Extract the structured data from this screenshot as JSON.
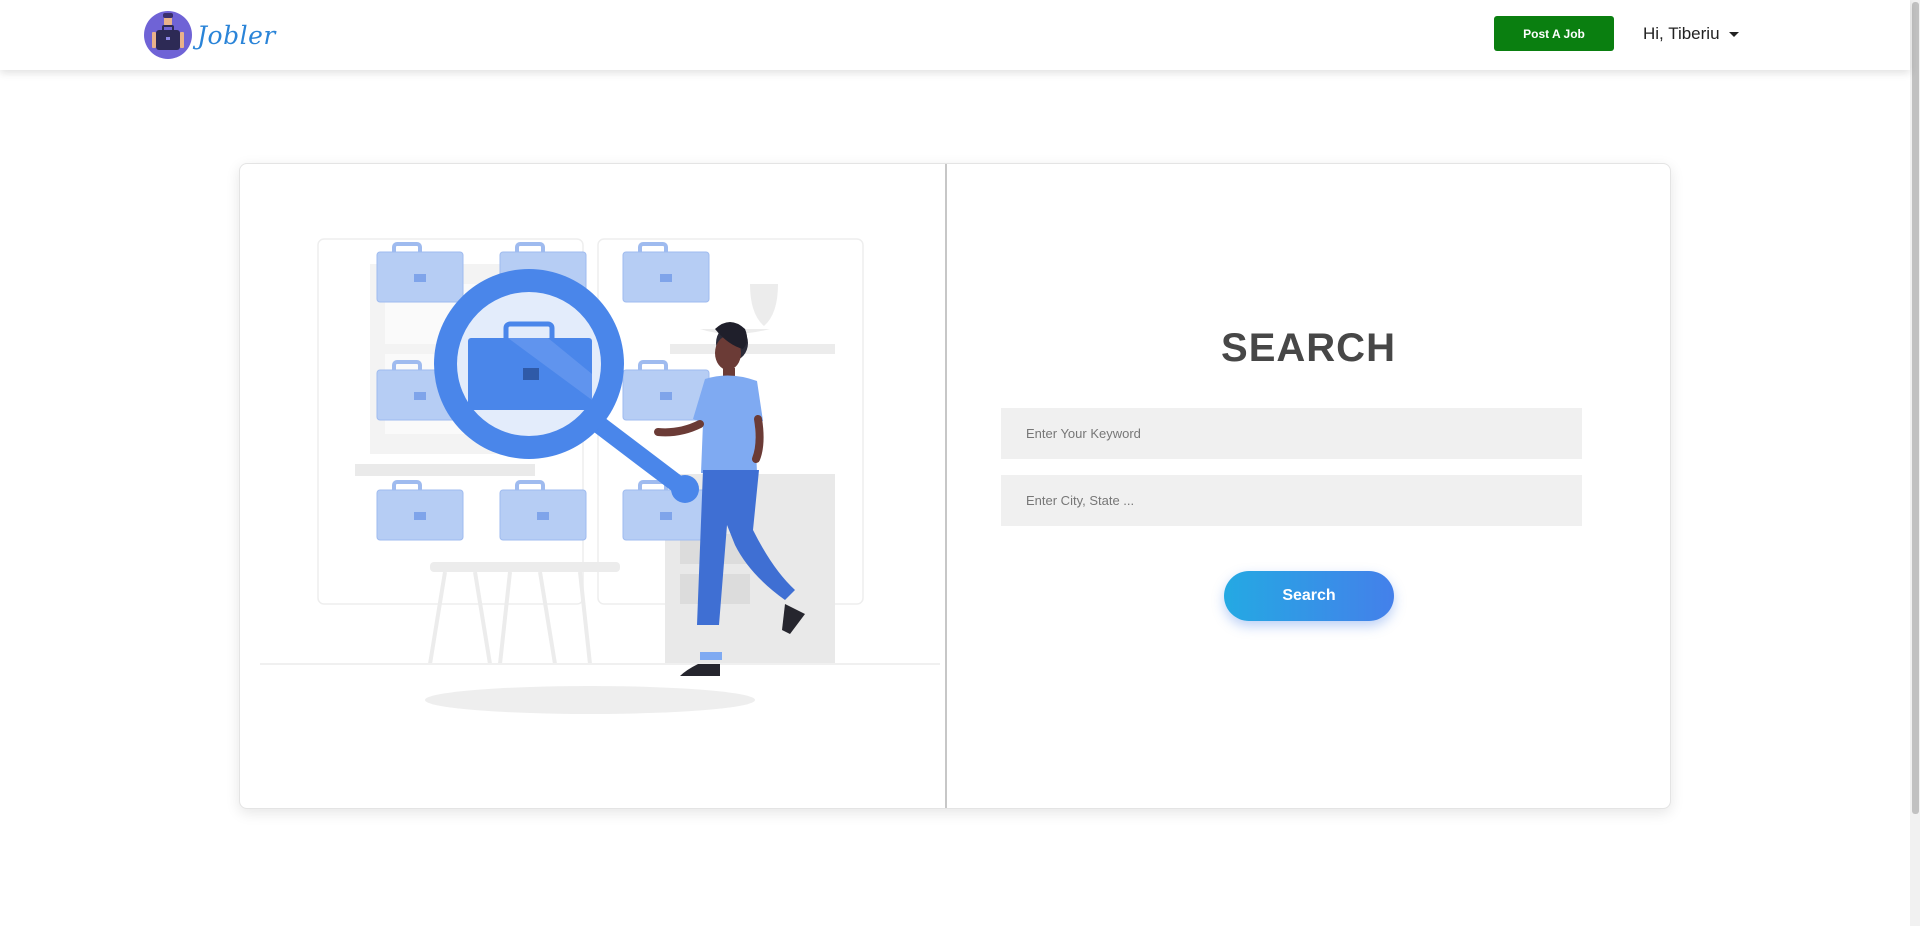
{
  "header": {
    "brand_name": "Jobler",
    "post_job_label": "Post A Job",
    "user_greeting": "Hi, Tiberiu"
  },
  "search": {
    "title": "SEARCH",
    "keyword_placeholder": "Enter Your Keyword",
    "location_placeholder": "Enter City, State ...",
    "button_label": "Search"
  },
  "colors": {
    "post_button": "#0a7f10",
    "brand_text": "#2a84d8",
    "search_button_start": "#24a9e3",
    "search_button_end": "#4480ea",
    "illustration_blue": "#4a86ea"
  },
  "icons": {
    "brand_logo": "briefcase-avatar-icon",
    "user_menu": "caret-down-icon",
    "illustration": "job-search-illustration"
  }
}
